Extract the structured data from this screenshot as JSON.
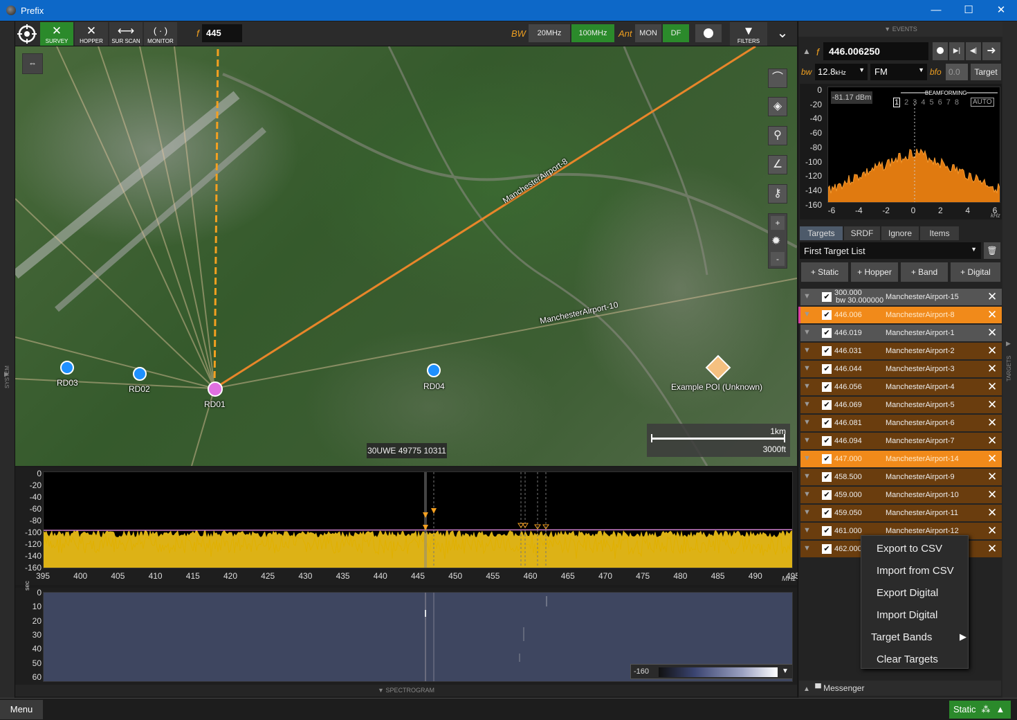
{
  "window": {
    "title": "Prefix",
    "minimize": "—",
    "maximize": "☐",
    "close": "✕"
  },
  "toolbar": {
    "modes": [
      {
        "label": "SURVEY",
        "glyph": "✕",
        "active": true
      },
      {
        "label": "HOPPER",
        "glyph": "✕",
        "active": false
      },
      {
        "label": "SUR SCAN",
        "glyph": "⟷",
        "active": false
      },
      {
        "label": "MONITOR",
        "glyph": "( · )",
        "active": false
      }
    ],
    "freq_label": "f",
    "freq_value": "445",
    "bw_label": "BW",
    "bw_options": [
      "20MHz",
      "100MHz"
    ],
    "bw_selected": "100MHz",
    "ant_label": "Ant",
    "ant_options": [
      "MON",
      "DF"
    ],
    "ant_selected": "DF",
    "filters_label": "FILTERS"
  },
  "side_labels": {
    "left": "SYSTEM",
    "right": "TARGETS"
  },
  "map": {
    "labels": {
      "ma8": "ManchesterAirport-8",
      "ma10": "ManchesterAirport-10",
      "poi": "Example POI (Unknown)"
    },
    "nodes": [
      {
        "name": "RD03",
        "color": "#1e90ff"
      },
      {
        "name": "RD02",
        "color": "#1e90ff"
      },
      {
        "name": "RD01",
        "color": "#e070e0"
      },
      {
        "name": "RD04",
        "color": "#1e90ff"
      }
    ],
    "scale": {
      "metric": "1km",
      "imperial": "3000ft"
    },
    "coords": "30UWE 49775 10311",
    "controls": {
      "zoom_in": "+",
      "zoom_out": "-"
    }
  },
  "spectrum": {
    "y_ticks": [
      "0",
      "-20",
      "-40",
      "-60",
      "-80",
      "-100",
      "-120",
      "-140",
      "-160"
    ],
    "x_ticks": [
      "395",
      "400",
      "405",
      "410",
      "415",
      "420",
      "425",
      "430",
      "435",
      "440",
      "445",
      "450",
      "455",
      "460",
      "465",
      "470",
      "475",
      "480",
      "485",
      "490",
      "495"
    ],
    "x_unit": "MHz"
  },
  "spectrogram": {
    "y_unit": "sec",
    "y_ticks": [
      "0",
      "10",
      "20",
      "30",
      "40",
      "50",
      "60"
    ],
    "color_min": "-160",
    "color_max": "0",
    "footer": "SPECTROGRAM"
  },
  "events": {
    "header": "EVENTS",
    "f_label": "f",
    "freq": "446.006250",
    "bw_label": "bw",
    "bw_value": "12.8",
    "bw_unit": "kHz",
    "mode": "FM",
    "bfo_label": "bfo",
    "bfo_value": "0.0",
    "target_btn": "Target",
    "power": "-81.17 dBm",
    "beamforming": "BEAMFORMING",
    "beam_channels": [
      "1",
      "2",
      "3",
      "4",
      "5",
      "6",
      "7",
      "8"
    ],
    "auto": "AUTO",
    "y_ticks": [
      "0",
      "-20",
      "-40",
      "-60",
      "-80",
      "-100",
      "-120",
      "-140",
      "-160"
    ],
    "x_ticks": [
      "-6",
      "-4",
      "-2",
      "0",
      "2",
      "4",
      "6"
    ],
    "x_unit": "kHz"
  },
  "tabs": [
    "Targets",
    "SRDF",
    "Ignore",
    "Items"
  ],
  "active_tab": "Targets",
  "target_list": {
    "name": "First Target List"
  },
  "add_buttons": [
    "+ Static",
    "+ Hopper",
    "+ Band",
    "+ Digital"
  ],
  "targets": [
    {
      "freq": "300.000",
      "sub": "bw 30.000000",
      "name": "ManchesterAirport-15",
      "style": "gray"
    },
    {
      "freq": "446.006",
      "sub": "",
      "name": "ManchesterAirport-8",
      "style": "sel"
    },
    {
      "freq": "446.019",
      "sub": "",
      "name": "ManchesterAirport-1",
      "style": "gray"
    },
    {
      "freq": "446.031",
      "sub": "",
      "name": "ManchesterAirport-2",
      "style": "brown"
    },
    {
      "freq": "446.044",
      "sub": "",
      "name": "ManchesterAirport-3",
      "style": "brown"
    },
    {
      "freq": "446.056",
      "sub": "",
      "name": "ManchesterAirport-4",
      "style": "brown"
    },
    {
      "freq": "446.069",
      "sub": "",
      "name": "ManchesterAirport-5",
      "style": "brown"
    },
    {
      "freq": "446.081",
      "sub": "",
      "name": "ManchesterAirport-6",
      "style": "brown"
    },
    {
      "freq": "446.094",
      "sub": "",
      "name": "ManchesterAirport-7",
      "style": "brown"
    },
    {
      "freq": "447.000",
      "sub": "",
      "name": "ManchesterAirport-14",
      "style": "sel"
    },
    {
      "freq": "458.500",
      "sub": "",
      "name": "ManchesterAirport-9",
      "style": "brown"
    },
    {
      "freq": "459.000",
      "sub": "",
      "name": "ManchesterAirport-10",
      "style": "brown"
    },
    {
      "freq": "459.050",
      "sub": "",
      "name": "ManchesterAirport-11",
      "style": "brown"
    },
    {
      "freq": "461.000",
      "sub": "",
      "name": "ManchesterAirport-12",
      "style": "brown"
    },
    {
      "freq": "462.000",
      "sub": "",
      "name": "",
      "style": "brown"
    }
  ],
  "context_menu": [
    "Export to CSV",
    "Import from CSV",
    "Export Digital",
    "Import Digital",
    "Target Bands",
    "Clear Targets"
  ],
  "messenger": "Messenger",
  "bottom": {
    "menu": "Menu",
    "status": "Static"
  }
}
